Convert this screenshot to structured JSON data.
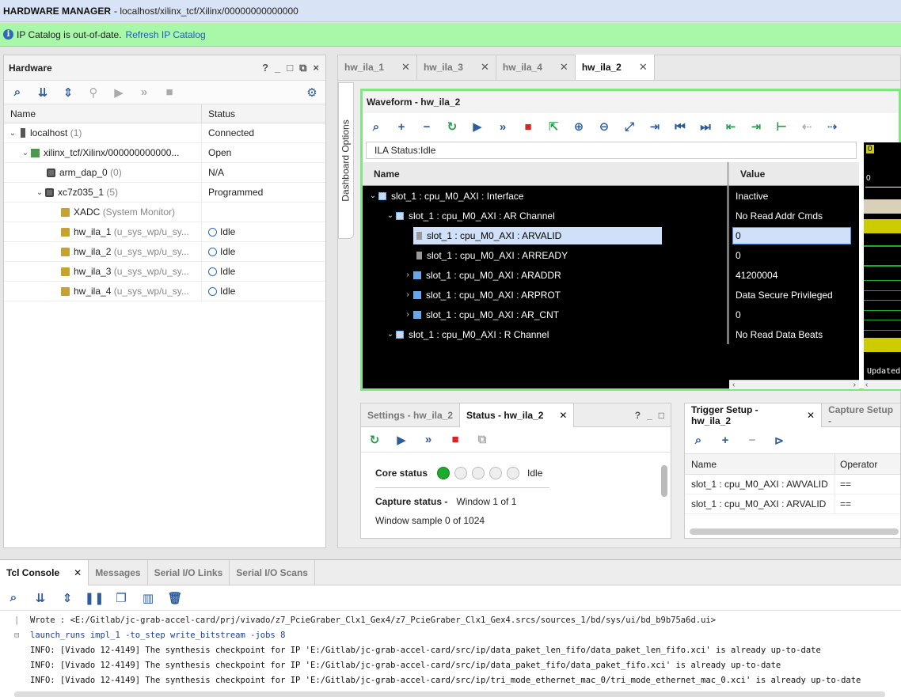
{
  "app": {
    "title_bold": "HARDWARE MANAGER",
    "title_path": "- localhost/xilinx_tcf/Xilinx/00000000000000"
  },
  "notice": {
    "text": "IP Catalog is out-of-date.",
    "link": "Refresh IP Catalog"
  },
  "hardware": {
    "title": "Hardware",
    "controls": [
      "?",
      "_",
      "□",
      "⧉",
      "×"
    ],
    "col_name": "Name",
    "col_status": "Status",
    "rows": [
      {
        "name": "localhost",
        "extra": "(1)",
        "status": "Connected"
      },
      {
        "name": "xilinx_tcf/Xilinx/000000000000...",
        "extra": "",
        "status": "Open"
      },
      {
        "name": "arm_dap_0",
        "extra": "(0)",
        "status": "N/A"
      },
      {
        "name": "xc7z035_1",
        "extra": "(5)",
        "status": "Programmed"
      },
      {
        "name": "XADC",
        "extra": "(System Monitor)",
        "status": ""
      },
      {
        "name": "hw_ila_1",
        "extra": "(u_sys_wp/u_sy...",
        "status": "Idle"
      },
      {
        "name": "hw_ila_2",
        "extra": "(u_sys_wp/u_sy...",
        "status": "Idle"
      },
      {
        "name": "hw_ila_3",
        "extra": "(u_sys_wp/u_sy...",
        "status": "Idle"
      },
      {
        "name": "hw_ila_4",
        "extra": "(u_sys_wp/u_sy...",
        "status": "Idle"
      }
    ]
  },
  "doc_tabs": [
    {
      "label": "hw_ila_1",
      "active": false
    },
    {
      "label": "hw_ila_3",
      "active": false
    },
    {
      "label": "hw_ila_4",
      "active": false
    },
    {
      "label": "hw_ila_2",
      "active": true
    }
  ],
  "dashboard_tab": "Dashboard Options",
  "waveform": {
    "title": "Waveform - hw_ila_2",
    "ila_status": "ILA Status:Idle",
    "col_name": "Name",
    "col_value": "Value",
    "rows": [
      {
        "name": "slot_1 : cpu_M0_AXI : Interface",
        "value": "Inactive"
      },
      {
        "name": "slot_1 : cpu_M0_AXI : AR Channel",
        "value": "No Read Addr Cmds"
      },
      {
        "name": "slot_1 : cpu_M0_AXI : ARVALID",
        "value": "0"
      },
      {
        "name": "slot_1 : cpu_M0_AXI : ARREADY",
        "value": "0"
      },
      {
        "name": "slot_1 : cpu_M0_AXI : ARADDR",
        "value": "41200004"
      },
      {
        "name": "slot_1 : cpu_M0_AXI : ARPROT",
        "value": "Data Secure Privileged"
      },
      {
        "name": "slot_1 : cpu_M0_AXI : AR_CNT",
        "value": "0"
      },
      {
        "name": "slot_1 : cpu_M0_AXI : R Channel",
        "value": "No Read Data Beats"
      }
    ],
    "wave_top_label": "0",
    "wave_axis_label": "0",
    "updated_label": "Updated"
  },
  "status_panel": {
    "tab_settings": "Settings - hw_ila_2",
    "tab_status": "Status - hw_ila_2",
    "core_status_label": "Core status",
    "core_status_value": "Idle",
    "capture_status_label": "Capture status -",
    "capture_status_value": "Window 1 of 1",
    "window_sample": "Window sample 0 of 1024"
  },
  "trigger_panel": {
    "tab_trigger": "Trigger Setup - hw_ila_2",
    "tab_capture": "Capture Setup -",
    "col_name": "Name",
    "col_operator": "Operator",
    "rows": [
      {
        "name": "slot_1 : cpu_M0_AXI : AWVALID",
        "operator": "=="
      },
      {
        "name": "slot_1 : cpu_M0_AXI : ARVALID",
        "operator": "=="
      }
    ]
  },
  "tcl": {
    "tabs": [
      "Tcl Console",
      "Messages",
      "Serial I/O Links",
      "Serial I/O Scans"
    ],
    "lines": [
      {
        "kind": "out0",
        "text": "Wrote  : <E:/Gitlab/jc-grab-accel-card/prj/vivado/z7_PcieGraber_Clx1_Gex4/z7_PcieGraber_Clx1_Gex4.srcs/sources_1/bd/sys/ui/bd_b9b75a6d.ui>"
      },
      {
        "kind": "cmd",
        "text": "launch_runs impl_1 -to_step write_bitstream -jobs 8"
      },
      {
        "kind": "out",
        "text": "INFO: [Vivado 12-4149] The synthesis checkpoint for IP 'E:/Gitlab/jc-grab-accel-card/src/ip/data_paket_len_fifo/data_paket_len_fifo.xci' is already up-to-date"
      },
      {
        "kind": "out",
        "text": "INFO: [Vivado 12-4149] The synthesis checkpoint for IP 'E:/Gitlab/jc-grab-accel-card/src/ip/data_paket_fifo/data_paket_fifo.xci' is already up-to-date"
      },
      {
        "kind": "out",
        "text": "INFO: [Vivado 12-4149] The synthesis checkpoint for IP 'E:/Gitlab/jc-grab-accel-card/src/ip/tri_mode_ethernet_mac_0/tri_mode_ethernet_mac_0.xci' is already up-to-date"
      }
    ]
  },
  "colors": {
    "notice_bg": "#a9f7a9",
    "waveform_border": "#7de87d",
    "led_on": "#1dab2e",
    "wave_yellow": "#cccc00"
  }
}
